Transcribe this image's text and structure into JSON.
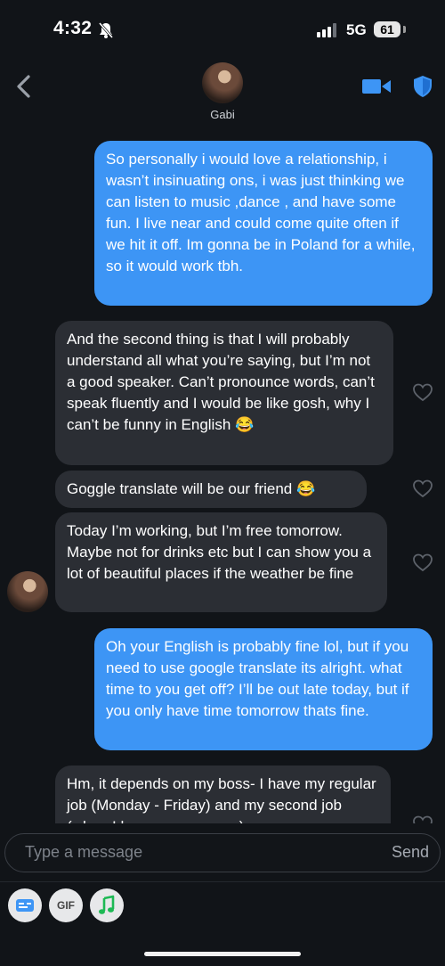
{
  "status_bar": {
    "time": "4:32",
    "network": "5G",
    "battery": "61"
  },
  "header": {
    "contact_name": "Gabi"
  },
  "messages": [
    {
      "direction": "outgoing",
      "text": "So personally i would love a relationship, i wasn’t insinuating ons, i was just thinking we can listen to music ,dance , and have some fun. I live near and could come quite often if we hit it off. Im gonna be in Poland for a while, so it would work tbh."
    },
    {
      "direction": "incoming",
      "text": "And the second thing is that I will probably understand all what you’re saying, but I’m not a good speaker. Can’t pronounce words, can’t speak fluently and I would be like gosh, why I can’t be funny in English 😂"
    },
    {
      "direction": "incoming",
      "text": "Goggle translate will be our friend 😂"
    },
    {
      "direction": "incoming",
      "text": "Today I’m  working, but I’m free tomorrow. Maybe not for drinks etc but I can show you a lot of beautiful places if the weather be fine"
    },
    {
      "direction": "outgoing",
      "text": "Oh your English is probably fine lol, but if you need to use google translate its alright. what time to you get off? I’ll be out late today, but if you only have time tomorrow thats fine."
    },
    {
      "direction": "incoming",
      "text": "Hm, it depends on my boss- I have my regular job (Monday - Friday) and my second job (when I have some space) so"
    }
  ],
  "composer": {
    "placeholder": "Type a message",
    "send_label": "Send"
  },
  "toolbar": {
    "gif_label": "GIF"
  },
  "colors": {
    "outgoing_bubble": "#3d95f5",
    "incoming_bubble": "#2b2e34",
    "accent": "#3d95f5",
    "background": "#111418"
  }
}
